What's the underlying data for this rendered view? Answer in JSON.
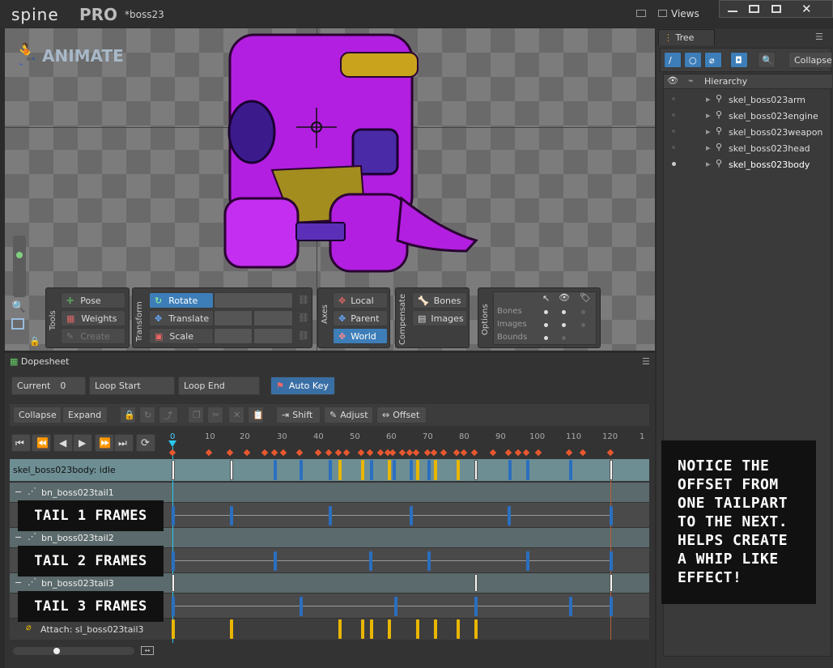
{
  "app": {
    "logo": "spine",
    "edition": "PRO",
    "file_title": "*boss23",
    "views_label": "Views",
    "mode": "ANIMATE"
  },
  "tree": {
    "tab": "Tree",
    "collapse": "Collapse",
    "hierarchy": "Hierarchy",
    "items": [
      "skel_boss023arm",
      "skel_boss023engine",
      "skel_boss023weapon",
      "skel_boss023head",
      "skel_boss023body"
    ]
  },
  "tools": {
    "group": "Tools",
    "pose": "Pose",
    "weights": "Weights",
    "create": "Create"
  },
  "transform": {
    "group": "Transform",
    "rotate": "Rotate",
    "translate": "Translate",
    "scale": "Scale"
  },
  "axes": {
    "group": "Axes",
    "local": "Local",
    "parent": "Parent",
    "world": "World"
  },
  "compensate": {
    "group": "Compensate",
    "bones": "Bones",
    "images": "Images"
  },
  "options": {
    "group": "Options",
    "bones": "Bones",
    "images": "Images",
    "bounds": "Bounds"
  },
  "dopesheet": {
    "tab": "Dopesheet",
    "current_label": "Current",
    "current_value": "0",
    "loop_start": "Loop Start",
    "loop_end": "Loop End",
    "auto_key": "Auto Key",
    "collapse": "Collapse",
    "expand": "Expand",
    "shift": "Shift",
    "adjust": "Adjust",
    "offset": "Offset",
    "ticks": [
      "0",
      "10",
      "20",
      "30",
      "40",
      "50",
      "60",
      "70",
      "80",
      "90",
      "100",
      "110",
      "120",
      "1"
    ],
    "rows": {
      "root": "skel_boss023body: idle",
      "tail1": "bn_boss023tail1",
      "tail2": "bn_boss023tail2",
      "tail3": "bn_boss023tail3",
      "attach": "Attach: sl_boss023tail3"
    }
  },
  "annotations": {
    "tail1": "TAIL 1 FRAMES",
    "tail2": "TAIL 2 FRAMES",
    "tail3": "TAIL 3 FRAMES",
    "note": "NOTICE THE OFFSET FROM ONE TAILPART TO THE NEXT. HELPS CREATE A WHIP LIKE EFFECT!"
  },
  "colors": {
    "accent": "#3d7eb8",
    "key_blue": "#2a6fc0",
    "key_yellow": "#e9b600",
    "character": "#b21fe0"
  }
}
